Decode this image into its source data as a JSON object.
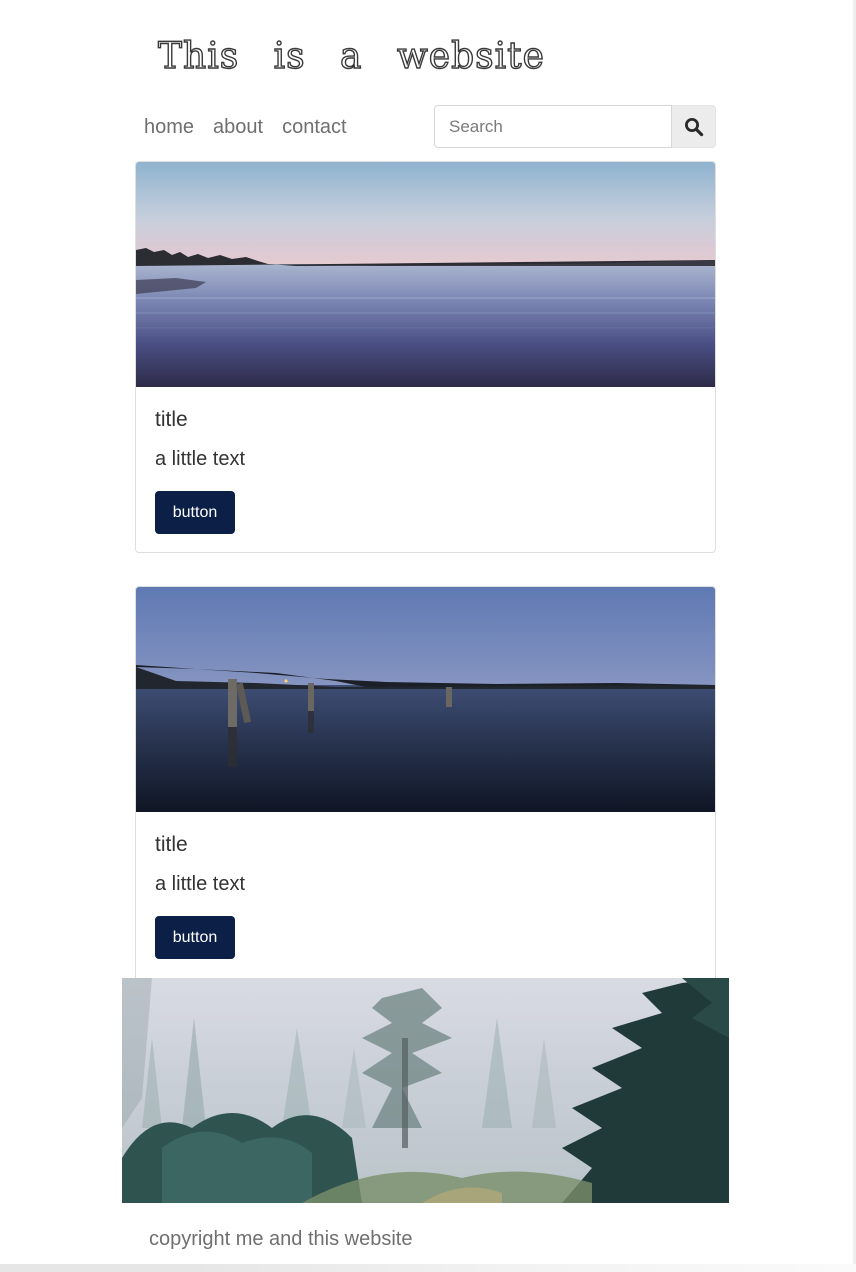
{
  "header": {
    "site_title": "This is a website"
  },
  "nav": {
    "items": [
      {
        "label": "home"
      },
      {
        "label": "about"
      },
      {
        "label": "contact"
      }
    ]
  },
  "search": {
    "placeholder": "Search",
    "value": "",
    "icon": "search-icon"
  },
  "cards": [
    {
      "image": "lake-at-dusk-image",
      "title": "title",
      "text": "a little text",
      "button_label": "button"
    },
    {
      "image": "pier-posts-lake-image",
      "title": "title",
      "text": "a little text",
      "button_label": "button"
    }
  ],
  "banner": {
    "image": "foggy-forest-image"
  },
  "footer": {
    "text": "copyright me and this website"
  },
  "colors": {
    "button_bg": "#0b1f47",
    "button_text": "#ffffff",
    "nav_text": "#6f6f6f",
    "body_text": "#333333",
    "search_button_bg": "#ececec"
  }
}
